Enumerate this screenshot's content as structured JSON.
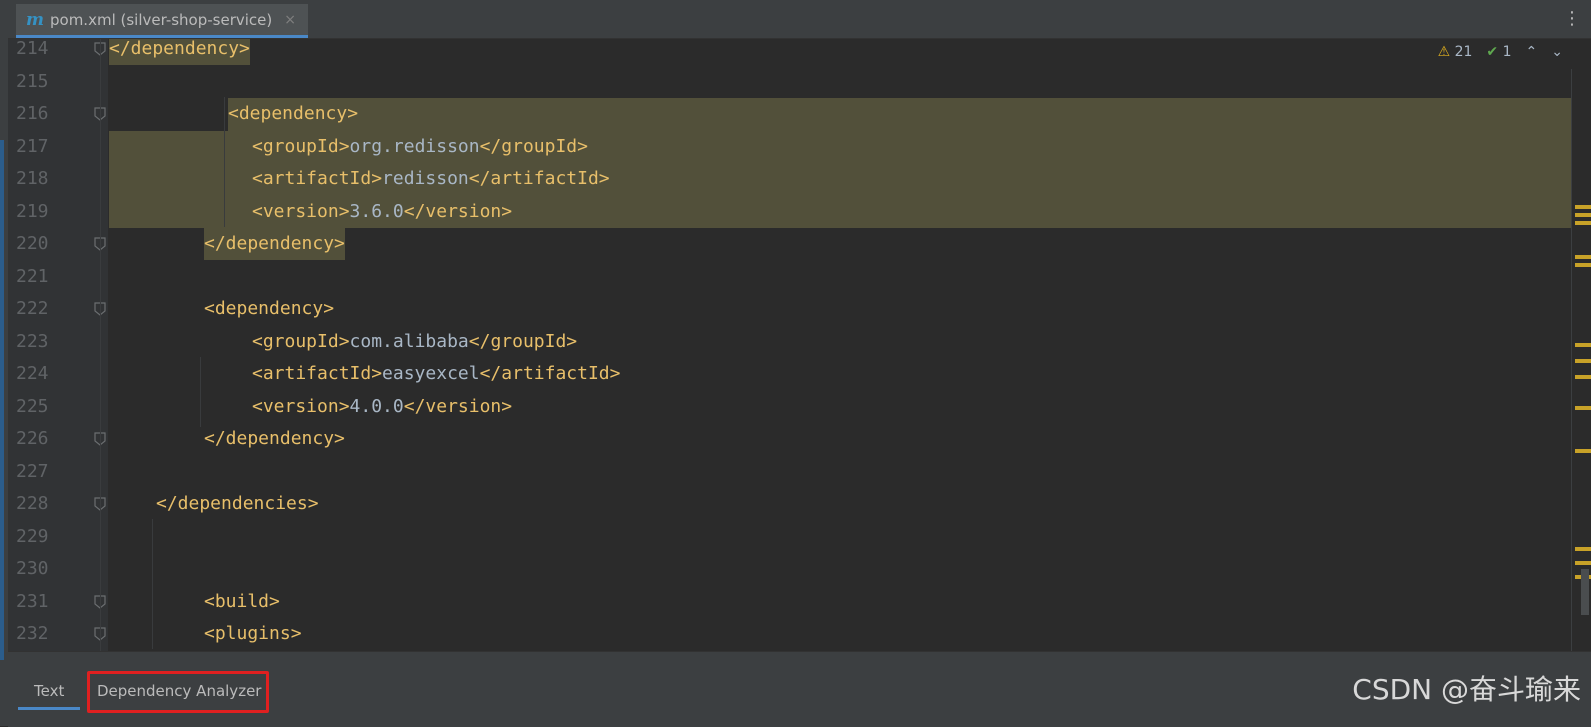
{
  "tab": {
    "icon_letter": "m",
    "title": "pom.xml (silver-shop-service)",
    "close_glyph": "×",
    "more_glyph": "⋮"
  },
  "inspection": {
    "warning_icon": "⚠",
    "warning_count": "21",
    "check_icon": "✔",
    "check_count": "1",
    "up_glyph": "⌃",
    "down_glyph": "⌄"
  },
  "lines": [
    {
      "no": "214",
      "segments": [
        {
          "t": "tag",
          "v": "</dependency>"
        }
      ]
    },
    {
      "no": "215",
      "segments": []
    },
    {
      "no": "216",
      "segments": [
        {
          "t": "tag",
          "v": "<dependency>"
        }
      ]
    },
    {
      "no": "217",
      "segments": [
        {
          "t": "tag",
          "v": "<groupId>"
        },
        {
          "t": "val",
          "v": "org.redisson"
        },
        {
          "t": "tag",
          "v": "</groupId>"
        }
      ]
    },
    {
      "no": "218",
      "segments": [
        {
          "t": "tag",
          "v": "<artifactId>"
        },
        {
          "t": "val",
          "v": "redisson"
        },
        {
          "t": "tag",
          "v": "</artifactId>"
        }
      ]
    },
    {
      "no": "219",
      "segments": [
        {
          "t": "tag",
          "v": "<version>"
        },
        {
          "t": "val",
          "v": "3.6.0"
        },
        {
          "t": "tag",
          "v": "</version>"
        }
      ]
    },
    {
      "no": "220",
      "segments": [
        {
          "t": "tag",
          "v": "</dependency>"
        }
      ]
    },
    {
      "no": "221",
      "segments": []
    },
    {
      "no": "222",
      "segments": [
        {
          "t": "tag",
          "v": "<dependency>"
        }
      ]
    },
    {
      "no": "223",
      "segments": [
        {
          "t": "tag",
          "v": "<groupId>"
        },
        {
          "t": "val",
          "v": "com.alibaba"
        },
        {
          "t": "tag",
          "v": "</groupId>"
        }
      ]
    },
    {
      "no": "224",
      "segments": [
        {
          "t": "tag",
          "v": "<artifactId>"
        },
        {
          "t": "val",
          "v": "easyexcel"
        },
        {
          "t": "tag",
          "v": "</artifactId>"
        }
      ]
    },
    {
      "no": "225",
      "segments": [
        {
          "t": "tag",
          "v": "<version>"
        },
        {
          "t": "val",
          "v": "4.0.0"
        },
        {
          "t": "tag",
          "v": "</version>"
        }
      ]
    },
    {
      "no": "226",
      "segments": [
        {
          "t": "tag",
          "v": "</dependency>"
        }
      ]
    },
    {
      "no": "227",
      "segments": []
    },
    {
      "no": "228",
      "segments": [
        {
          "t": "tag",
          "v": "</dependencies>"
        }
      ]
    },
    {
      "no": "229",
      "segments": []
    },
    {
      "no": "230",
      "segments": []
    },
    {
      "no": "231",
      "segments": [
        {
          "t": "tag",
          "v": "<build>"
        }
      ]
    },
    {
      "no": "232",
      "segments": [
        {
          "t": "tag",
          "v": "<plugins>"
        }
      ]
    }
  ],
  "bottom_tabs": [
    {
      "label": "Text",
      "active": true
    },
    {
      "label": "Dependency Analyzer",
      "active": false
    }
  ],
  "watermark": "CSDN @奋斗瑜来",
  "colors": {
    "tag": "#e8bf6a",
    "value": "#a9b7c6",
    "highlight": "#52503a",
    "accent": "#4a88c7",
    "warning": "#e0b01f",
    "annotation_box": "#e02020"
  }
}
